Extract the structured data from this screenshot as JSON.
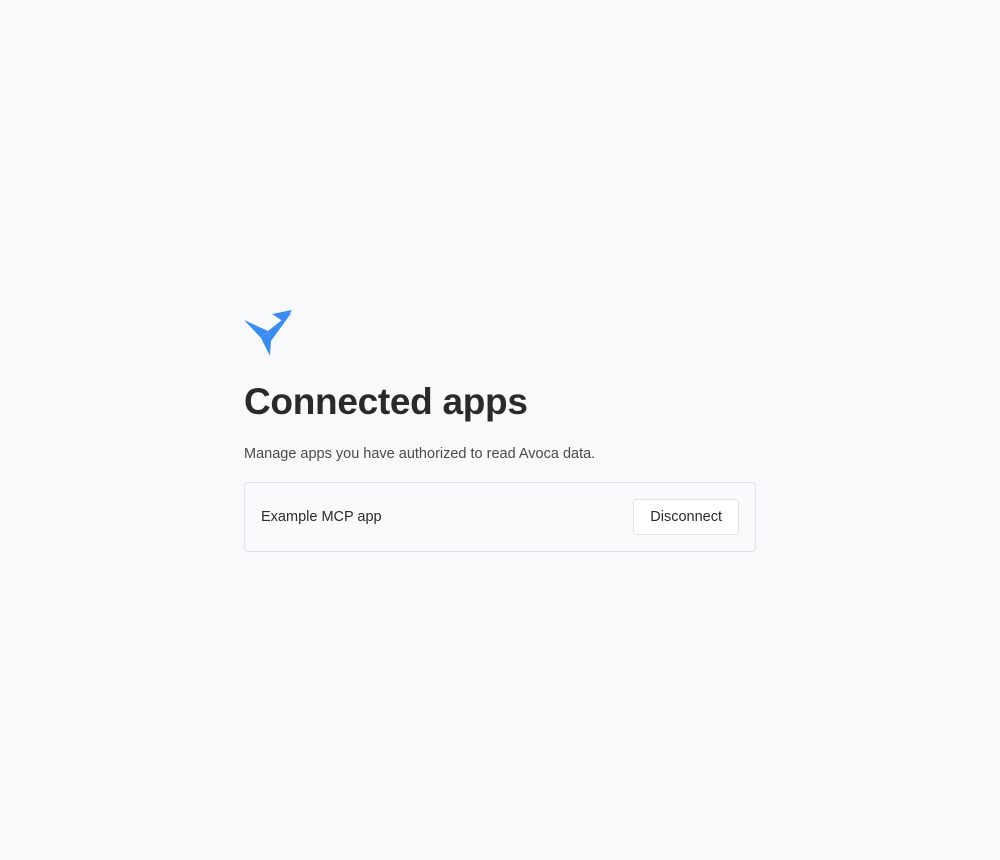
{
  "brand": {
    "logo_icon": "paper-plane-bird-icon",
    "accent_color": "#3b8cef"
  },
  "header": {
    "title": "Connected apps",
    "subtitle": "Manage apps you have authorized to read Avoca data."
  },
  "apps": [
    {
      "name": "Example MCP app",
      "action_label": "Disconnect"
    }
  ]
}
